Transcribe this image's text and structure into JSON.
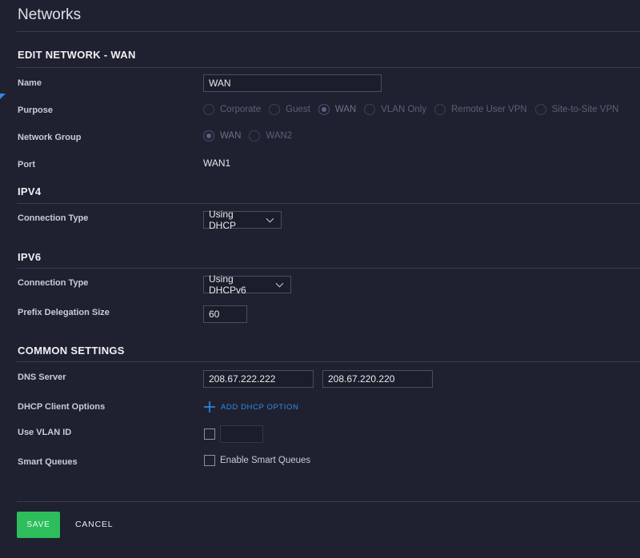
{
  "page": {
    "title": "Networks"
  },
  "sections": {
    "edit": "EDIT NETWORK - WAN",
    "ipv4": "IPV4",
    "ipv6": "IPV6",
    "common": "COMMON SETTINGS"
  },
  "name": {
    "label": "Name",
    "value": "WAN"
  },
  "purpose": {
    "label": "Purpose",
    "options": [
      "Corporate",
      "Guest",
      "WAN",
      "VLAN Only",
      "Remote User VPN",
      "Site-to-Site VPN"
    ],
    "selected": "WAN"
  },
  "network_group": {
    "label": "Network Group",
    "options": [
      "WAN",
      "WAN2"
    ],
    "selected": "WAN"
  },
  "port": {
    "label": "Port",
    "value": "WAN1"
  },
  "ipv4": {
    "connection_label": "Connection Type",
    "connection_value": "Using DHCP"
  },
  "ipv6": {
    "connection_label": "Connection Type",
    "connection_value": "Using DHCPv6",
    "prefix_label": "Prefix Delegation Size",
    "prefix_value": "60"
  },
  "dns": {
    "label": "DNS Server",
    "primary": "208.67.222.222",
    "secondary": "208.67.220.220"
  },
  "dhcp_client": {
    "label": "DHCP Client Options",
    "add_label": "ADD DHCP OPTION"
  },
  "vlan": {
    "label": "Use VLAN ID",
    "value": ""
  },
  "smart_queues": {
    "label": "Smart Queues",
    "checkbox_label": "Enable Smart Queues"
  },
  "actions": {
    "save": "SAVE",
    "cancel": "CANCEL"
  },
  "colors": {
    "accent": "#2f8be8",
    "save": "#2ebd5c",
    "background": "#1f2130"
  }
}
